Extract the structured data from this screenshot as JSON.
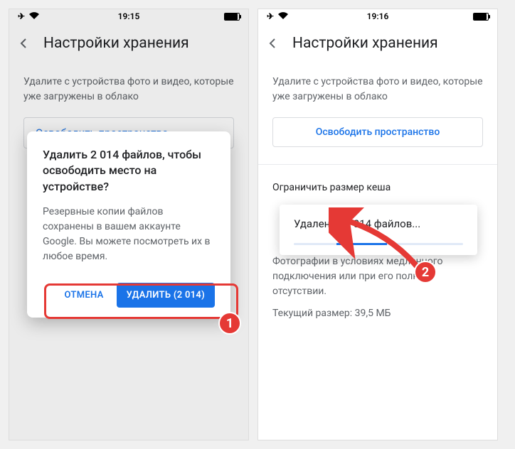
{
  "left": {
    "status": {
      "time": "19:15"
    },
    "header": {
      "title": "Настройки хранения"
    },
    "description": "Удалите с устройства фото и видео, которые уже загружены в облако",
    "partialButton": "Освободить пространство",
    "dialog": {
      "title": "Удалить 2 014 файлов, чтобы освободить место на устройстве?",
      "body": "Резервные копии файлов сохранены в вашем аккаунте Google. Вы можете посмотреть их в любое время.",
      "cancel": "ОТМЕНА",
      "delete": "УДАЛИТЬ (2 014)"
    }
  },
  "right": {
    "status": {
      "time": "19:16"
    },
    "header": {
      "title": "Настройки хранения"
    },
    "description": "Удалите с устройства фото и видео, которые уже загружены в облако",
    "freeButton": "Освободить пространство",
    "cache": {
      "title": "Ограничить размер кеша",
      "desc": "Фотографии в условиях медленного подключения или при его полном отсутствии.",
      "size": "Текущий размер: 39,5 МБ"
    },
    "progress": {
      "title": "Удаление 2 014 файлов..."
    }
  },
  "badges": {
    "one": "1",
    "two": "2"
  }
}
